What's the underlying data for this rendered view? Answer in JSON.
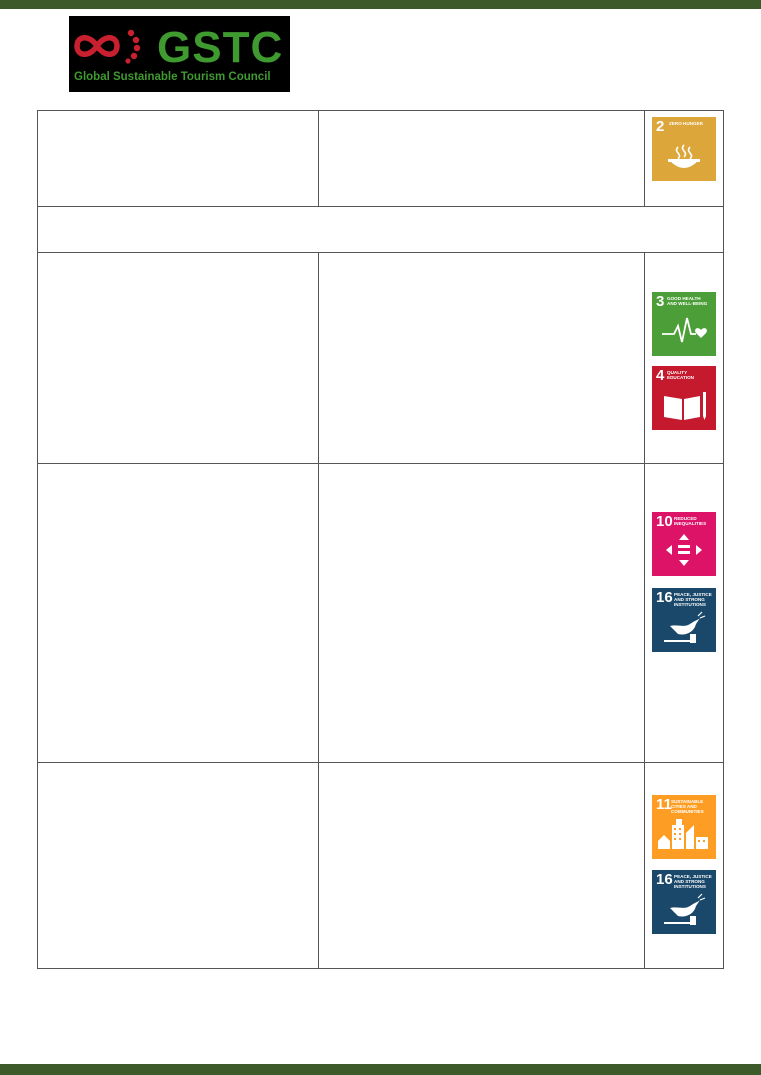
{
  "logo": {
    "wordmark": "GSTC",
    "tagline": "Global Sustainable Tourism Council",
    "colors": {
      "green": "#3f9a30",
      "red": "#c8202f",
      "background": "#000000"
    }
  },
  "page": {
    "band_color": "#3c5a2a"
  },
  "sdg_icons": [
    {
      "number": "2",
      "label": "ZERO HUNGER",
      "color": "#dda63a",
      "icon": "food-bowl-icon"
    },
    {
      "number": "3",
      "label": "GOOD HEALTH AND WELL-BEING",
      "color": "#4c9f38",
      "icon": "heartbeat-icon"
    },
    {
      "number": "4",
      "label": "QUALITY EDUCATION",
      "color": "#c5192d",
      "icon": "book-pencil-icon"
    },
    {
      "number": "10",
      "label": "REDUCED INEQUALITIES",
      "color": "#dd1367",
      "icon": "equality-arrows-icon"
    },
    {
      "number": "16",
      "label": "PEACE, JUSTICE AND STRONG INSTITUTIONS",
      "color": "#19486a",
      "icon": "dove-gavel-icon"
    },
    {
      "number": "11",
      "label": "SUSTAINABLE CITIES AND COMMUNITIES",
      "color": "#fd9d24",
      "icon": "city-buildings-icon"
    },
    {
      "number": "16",
      "label": "PEACE, JUSTICE AND STRONG INSTITUTIONS",
      "color": "#19486a",
      "icon": "dove-gavel-icon"
    }
  ]
}
